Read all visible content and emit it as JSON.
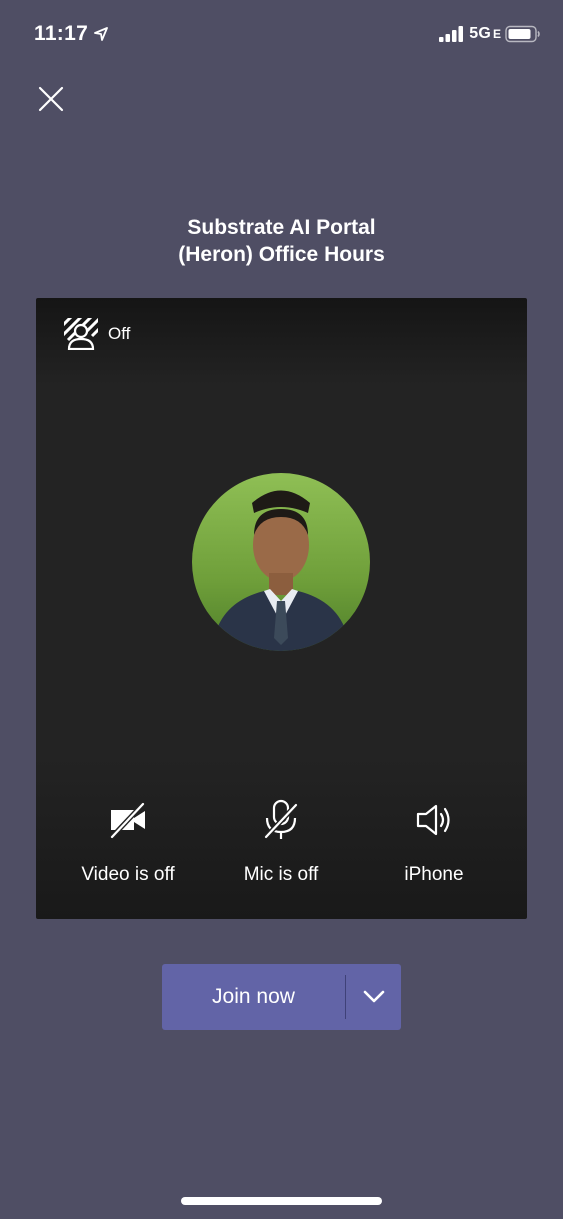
{
  "status_bar": {
    "time": "11:17",
    "network": "5G",
    "network_suffix": "E",
    "icons": [
      "location-arrow-icon",
      "cellular-signal-icon",
      "battery-icon"
    ]
  },
  "meeting": {
    "title_line1": "Substrate AI Portal",
    "title_line2": "(Heron) Office Hours"
  },
  "preview": {
    "background_effects_label": "Off",
    "controls": {
      "video_label": "Video is off",
      "mic_label": "Mic is off",
      "audio_label": "iPhone"
    }
  },
  "join": {
    "label": "Join now"
  },
  "colors": {
    "background": "#4f4e64",
    "panel": "#232323",
    "accent": "#6264a7"
  }
}
